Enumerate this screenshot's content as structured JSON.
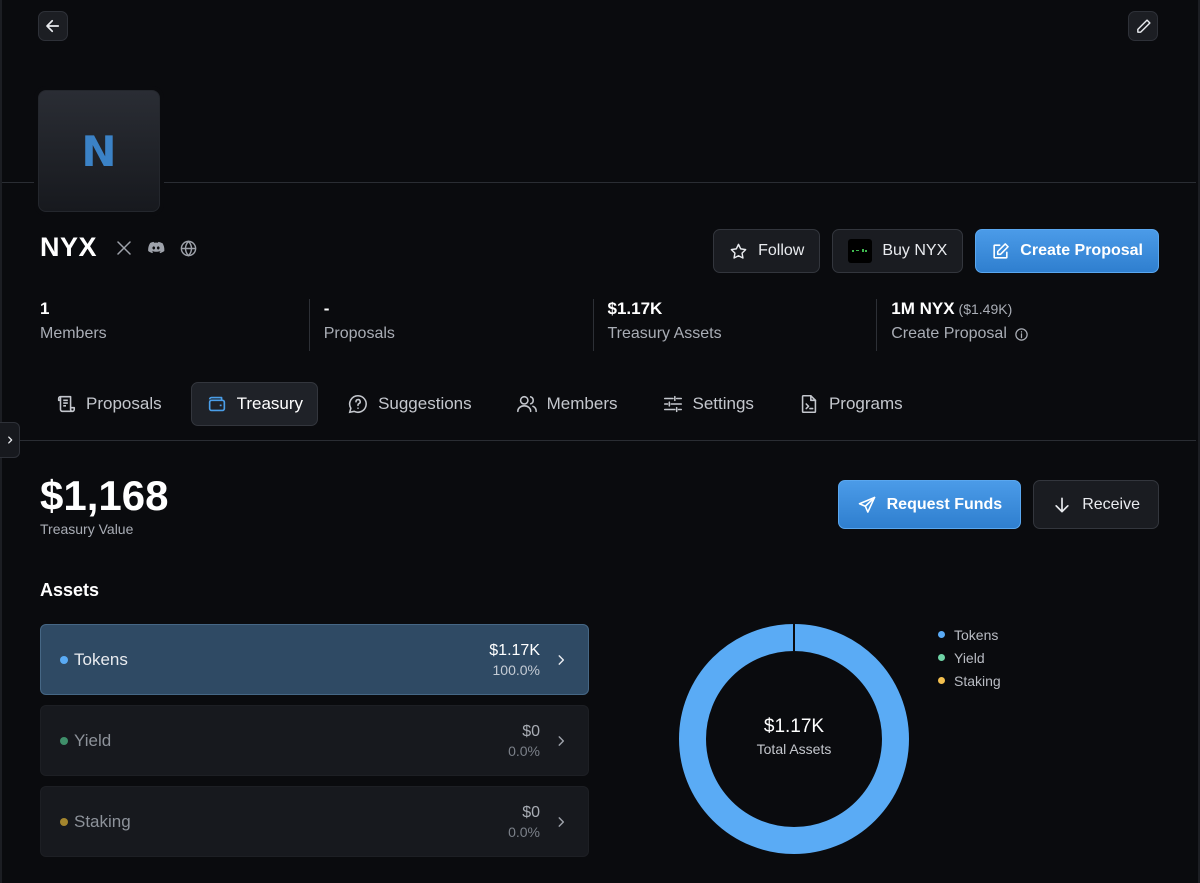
{
  "header": {
    "back_icon": "arrow-left-icon",
    "edit_icon": "pencil-icon"
  },
  "org": {
    "avatar_letter": "N",
    "name": "NYX",
    "socials": [
      "x-icon",
      "discord-icon",
      "globe-icon"
    ]
  },
  "actions": {
    "follow_label": "Follow",
    "buy_label": "Buy NYX",
    "create_proposal_label": "Create Proposal"
  },
  "stats": [
    {
      "value": "1",
      "label": "Members"
    },
    {
      "value": "-",
      "label": "Proposals"
    },
    {
      "value": "$1.17K",
      "label": "Treasury Assets"
    },
    {
      "value": "1M NYX",
      "sub": "($1.49K)",
      "label": "Create Proposal",
      "info_icon": "info-icon"
    }
  ],
  "tabs": [
    {
      "label": "Proposals",
      "icon": "scroll-icon",
      "active": false
    },
    {
      "label": "Treasury",
      "icon": "wallet-icon",
      "active": true
    },
    {
      "label": "Suggestions",
      "icon": "question-bubble-icon",
      "active": false
    },
    {
      "label": "Members",
      "icon": "users-icon",
      "active": false
    },
    {
      "label": "Settings",
      "icon": "sliders-icon",
      "active": false
    },
    {
      "label": "Programs",
      "icon": "terminal-file-icon",
      "active": false
    }
  ],
  "treasury": {
    "value": "$1,168",
    "label": "Treasury Value",
    "request_funds_label": "Request Funds",
    "receive_label": "Receive"
  },
  "assets": {
    "heading": "Assets",
    "rows": [
      {
        "name": "Tokens",
        "amount": "$1.17K",
        "pct": "100.0%",
        "color": "#5aabf5",
        "active": true
      },
      {
        "name": "Yield",
        "amount": "$0",
        "pct": "0.0%",
        "color": "#3f8f6a",
        "active": false
      },
      {
        "name": "Staking",
        "amount": "$0",
        "pct": "0.0%",
        "color": "#a3852d",
        "active": false
      }
    ]
  },
  "chart_data": {
    "type": "pie",
    "categories": [
      "Tokens",
      "Yield",
      "Staking"
    ],
    "values": [
      1168,
      0,
      0
    ],
    "colors": [
      "#5aabf5",
      "#6fd3a6",
      "#f4c04f"
    ],
    "center_value": "$1.17K",
    "center_label": "Total Assets",
    "legend_placement": "right"
  },
  "colors": {
    "accent": "#3f8fdf",
    "background": "#0a0b0e"
  }
}
